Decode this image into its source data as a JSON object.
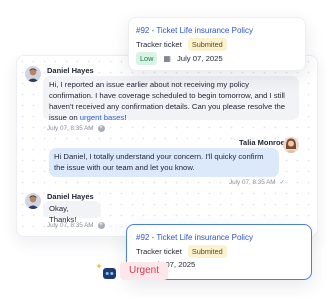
{
  "ticket_top": {
    "title": "#92 - Ticket Life insurance Policy",
    "type": "Tracker ticket",
    "status": "Submited",
    "priority": "Low",
    "date": "July 07, 2025"
  },
  "chat": {
    "messages": [
      {
        "sender": "Daniel Hayes",
        "text_before_link": "Hi, I reported an issue earlier about not receiving my policy confirmation. I have coverage scheduled to begin tomorrow, and I still haven't received any confirmation details. Can you please resolve the issue on ",
        "link_text": "urgent bases",
        "text_after_link": "!",
        "time": "July 07, 8:35 AM"
      },
      {
        "sender": "Talia Monroe",
        "text": "Hi Daniel, I totally understand your concern. I'll quicky confirm the issue with our team and let you know.",
        "time": "July 07, 8:35 AM"
      },
      {
        "sender": "Daniel Hayes",
        "text": "Okay, Thanks!",
        "time": "July 07, 8:35 AM"
      }
    ]
  },
  "ticket_bottom": {
    "title": "#92 - Ticket Life insurance Policy",
    "type": "Tracker ticket",
    "status": "Submited",
    "date": "July 07, 2025"
  },
  "urgent_label": "Urgent",
  "icons": {
    "calendar": "calendar-icon",
    "plus": "plus-icon",
    "check": "check-icon",
    "bot": "bot-sparkle-icon"
  },
  "colors": {
    "link": "#2f5fdc",
    "outgoing_bubble": "#dce9fb",
    "low_badge": "#d9f3e4",
    "submitted_badge": "#fdf2d0",
    "urgent_badge": "#fde7ea",
    "urgent_text": "#d33a4d",
    "card_border_active": "#4a7fe0"
  }
}
